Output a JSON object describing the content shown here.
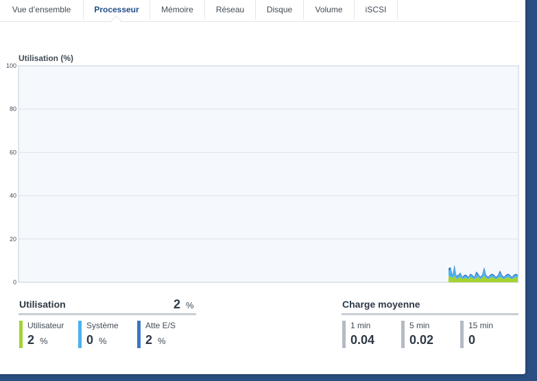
{
  "tabs": [
    {
      "label": "Vue d’ensemble",
      "active": false
    },
    {
      "label": "Processeur",
      "active": true
    },
    {
      "label": "Mémoire",
      "active": false
    },
    {
      "label": "Réseau",
      "active": false
    },
    {
      "label": "Disque",
      "active": false
    },
    {
      "label": "Volume",
      "active": false
    },
    {
      "label": "iSCSI",
      "active": false
    }
  ],
  "chart": {
    "title": "Utilisation (%)"
  },
  "chart_data": {
    "type": "area",
    "title": "Utilisation (%)",
    "xlabel": "",
    "ylabel": "",
    "ylim": [
      0,
      100
    ],
    "yticks": [
      "100",
      "80",
      "60",
      "40",
      "20",
      "0"
    ],
    "grid": true,
    "x": [
      0,
      1,
      2,
      3,
      4,
      5,
      6,
      7,
      8,
      9,
      10,
      11,
      12,
      13,
      14,
      15,
      16,
      17,
      18,
      19,
      20,
      21,
      22,
      23,
      24,
      25,
      26,
      27,
      28,
      29,
      30,
      31,
      32,
      33,
      34,
      35
    ],
    "series": [
      {
        "name": "Utilisateur",
        "color": "#a4d233",
        "values": [
          3,
          2.5,
          2,
          3,
          1.5,
          2,
          2.5,
          1.5,
          2,
          2,
          1.5,
          2.5,
          2,
          1.5,
          2,
          2.5,
          1.5,
          2,
          3,
          2,
          1.5,
          2,
          2.5,
          2,
          1.5,
          2,
          2.5,
          2,
          1.5,
          2,
          2.5,
          2,
          1.5,
          2,
          2.5,
          2
        ]
      },
      {
        "name": "Système",
        "color": "#4bb1ef",
        "values": [
          2.5,
          3.5,
          1,
          4,
          1,
          1,
          1.5,
          0.5,
          1,
          1,
          0.5,
          1,
          1,
          0.5,
          2,
          1,
          0.5,
          1,
          3,
          1,
          0.5,
          1,
          1,
          1,
          0.5,
          1,
          2,
          1,
          0.5,
          1,
          1,
          1,
          0.5,
          1,
          1,
          1
        ]
      },
      {
        "name": "Atte E/S",
        "color": "#3a76c4",
        "values": [
          1,
          1,
          0.5,
          1,
          0.5,
          0.5,
          0.5,
          0.5,
          0.5,
          0.5,
          0.5,
          0.5,
          0.5,
          0.5,
          1,
          0.5,
          0.5,
          0.5,
          1,
          0.5,
          0.5,
          0.5,
          0.5,
          0.5,
          0.5,
          0.5,
          1,
          0.5,
          0.5,
          0.5,
          0.5,
          0.5,
          0.5,
          0.5,
          0.5,
          0.5
        ]
      }
    ]
  },
  "utilisation": {
    "title": "Utilisation",
    "value": "2",
    "unit": "%",
    "metrics": [
      {
        "label": "Utilisateur",
        "value": "2",
        "unit": "%",
        "color": "#a4d233"
      },
      {
        "label": "Système",
        "value": "0",
        "unit": "%",
        "color": "#4bb1ef"
      },
      {
        "label": "Atte E/S",
        "value": "2",
        "unit": "%",
        "color": "#3a76c4"
      }
    ]
  },
  "charge": {
    "title": "Charge moyenne",
    "metrics": [
      {
        "label": "1 min",
        "value": "0.04",
        "color": "#b4bbc4"
      },
      {
        "label": "5 min",
        "value": "0.02",
        "color": "#b4bbc4"
      },
      {
        "label": "15 min",
        "value": "0",
        "color": "#b4bbc4"
      }
    ]
  }
}
